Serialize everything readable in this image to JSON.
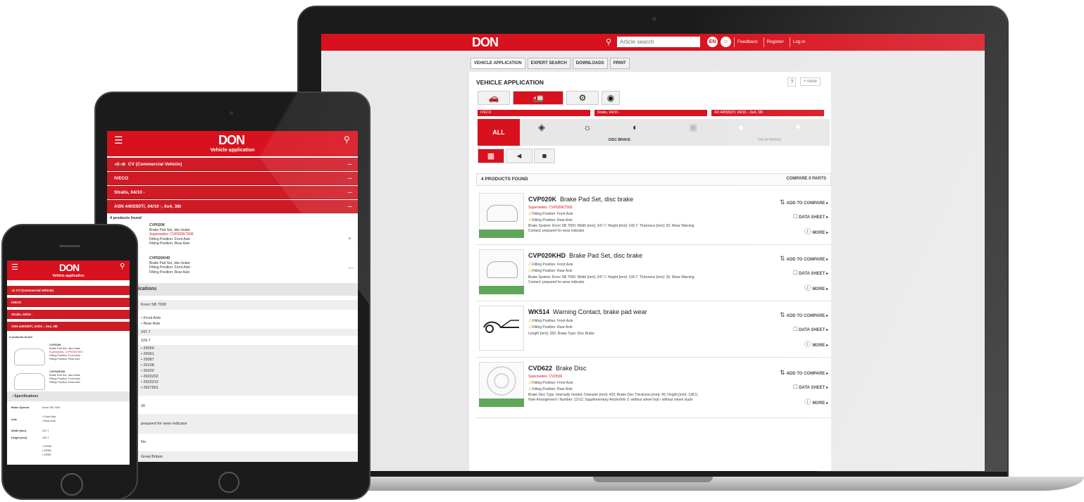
{
  "colors": {
    "brand_red": "#d7111d",
    "dark_device": "#1b1b1b",
    "highlight_green": "#5fa65a"
  },
  "laptop": {
    "header": {
      "logo": "DON",
      "search_placeholder": "Article search",
      "links": [
        "Feedback",
        "Register",
        "Log in"
      ],
      "circle_icons": [
        "EN",
        "☺"
      ]
    },
    "tabs": [
      "VEHICLE APPLICATION",
      "EXPERT SEARCH",
      "DOWNLOADS",
      "PRINT"
    ],
    "panel": {
      "title": "VEHICLE APPLICATION",
      "help": "?",
      "more": "+ more",
      "selects": [
        "IVECO",
        "Stralis, 04/10 -",
        "AD 440S50T/, 04/10 -, 6x4, 38t"
      ],
      "category_all": "ALL",
      "category_label_disc": "DISC BRAKE",
      "category_label_drum": "DRUM BRAKE"
    },
    "results": {
      "count_label": "4 PRODUCTS FOUND",
      "compare_label": "COMPARE 0 PARTS"
    },
    "actions": {
      "compare": "ADD TO COMPARE ▸",
      "sheet": "DATA SHEET ▸",
      "more": "MORE ▸"
    },
    "products": [
      {
        "code": "CVP020K",
        "name": "Brake Pad Set, disc brake",
        "supersedes": "Supersedes: CVP020K7500",
        "fitting1": "Fitting Position: Front Axle",
        "fitting2": "Fitting Position: Rear Axle",
        "specs": "Brake System: Knorr SB 7000; Width [mm]: 247.7; Height [mm]: 109.7; Thickness [mm]: 30; Wear Warning",
        "specs2": "Contact: prepared for wear indicator"
      },
      {
        "code": "CVP020KHD",
        "name": "Brake Pad Set, disc brake",
        "supersedes": "",
        "fitting1": "Fitting Position: Front Axle",
        "fitting2": "Fitting Position: Rear Axle",
        "specs": "Brake System: Knorr SB 7000; Width [mm]: 247.7; Height [mm]: 109.7; Thickness [mm]: 30; Wear Warning",
        "specs2": "Contact: prepared for wear indicator"
      },
      {
        "code": "WK514",
        "name": "Warning Contact, brake pad wear",
        "supersedes": "",
        "fitting1": "Fitting Position: Front Axle",
        "fitting2": "Fitting Position: Rear Axle",
        "specs": "Length [mm]: 282; Brake Type: Disc Brake",
        "specs2": ""
      },
      {
        "code": "CVD622",
        "name": "Brake Disc",
        "supersedes": "Supersedes: CVD536",
        "fitting1": "Fitting Position: Front Axle",
        "fitting2": "Fitting Position: Rear Axle",
        "specs": "Brake Disc Type: Internally Vented; Diameter [mm]: 432; Brake Disc Thickness [mm]: 45; Height [mm]: 138.5;",
        "specs2": "Hole Arrangement / Number: 12/12; Supplementary Article/Info 2: without wheel hub / without wheel studs"
      }
    ]
  },
  "tablet": {
    "logo": "DON",
    "subtitle": "Vehicle application",
    "rows": [
      "CV (Commercial Vehicle)",
      "IVECO",
      "Stralis, 04/10 -",
      "ASN 440S50T/, 04/10 -, 6x4, 38t"
    ],
    "found": "4 products found",
    "item1": [
      "CVP020K",
      "Brake Pad Set, disc brake",
      "Supersedes: CVP020K7500",
      "Fitting Position: Front Axle",
      "Fitting Position: Rear Axle"
    ],
    "item2": [
      "CVP020KHD",
      "Brake Pad Set, disc brake",
      "Fitting Position: Front Axle",
      "Fitting Position: Rear Axle"
    ],
    "spec_header": "ications",
    "spec_values": [
      "Knorr SB 7000",
      "• Front Axle",
      "• Rear Axle",
      "247.7",
      "109.7",
      "• 29059",
      "• 29061",
      "• 29087",
      "• 29108",
      "• 29202",
      "• 2920202",
      "• 2920212",
      "• 2927801",
      "30",
      "prepared for wear indicator",
      "No",
      "Great Britain"
    ]
  },
  "phone": {
    "logo": "DON",
    "subtitle": "Vehicle application",
    "rows": [
      "CV (Commercial Vehicle)",
      "IVECO",
      "Stralis, 04/10 -",
      "ASN 440S50T/, 04/10 -, 6x4, 38t"
    ],
    "found": "4 products found",
    "item1": [
      "CVP020K",
      "Brake Pad Set, disc brake",
      "Supersedes: CVP020K7500",
      "Fitting Position: Front Axle",
      "Fitting Position: Rear Axle"
    ],
    "item2": [
      "CVP020KHD",
      "Brake Pad Set, disc brake",
      "Fitting Position: Front Axle",
      "Fitting Position: Rear Axle"
    ],
    "spec_header": "Specifications",
    "spec_labels": [
      "Brake System:",
      "Axle",
      "Width [mm]",
      "Height [mm]"
    ],
    "spec_values": [
      "Knorr SB 7000",
      "• Front Axle",
      "• Rear Axle",
      "247.7",
      "109.7",
      "• 29059",
      "• 29061",
      "• 29087"
    ]
  }
}
